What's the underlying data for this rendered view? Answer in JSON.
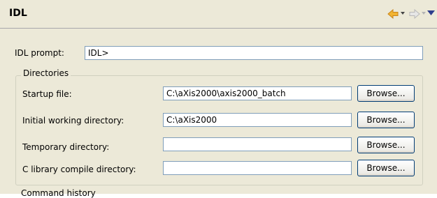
{
  "header": {
    "title": "IDL",
    "back_icon": "back-arrow-icon",
    "forward_icon": "forward-arrow-icon",
    "menu_icon": "view-menu-icon"
  },
  "form": {
    "idl_prompt_label": "IDL prompt:",
    "idl_prompt_value": "IDL>",
    "directories_legend": "Directories",
    "rows": [
      {
        "label": "Startup file:",
        "value": "C:\\aXis2000\\axis2000_batch",
        "button": "Browse..."
      },
      {
        "label": "Initial working directory:",
        "value": "C:\\aXis2000",
        "button": "Browse..."
      },
      {
        "label": "Temporary directory:",
        "value": "",
        "button": "Browse..."
      },
      {
        "label": "C library compile directory:",
        "value": "",
        "button": "Browse..."
      }
    ],
    "next_section_partial": "Command history"
  },
  "colors": {
    "accent_arrow": "#f2b431",
    "menu_arrow": "#2e3e8c"
  }
}
